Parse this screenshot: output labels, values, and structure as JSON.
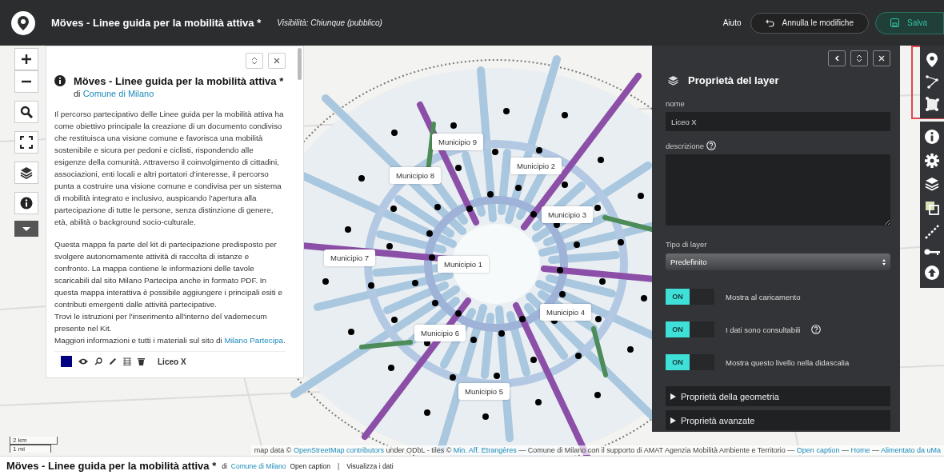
{
  "header": {
    "title": "Möves - Linee guida per la mobilità attiva *",
    "visibility": "Visibilità: Chiunque (pubblico)",
    "help_link": "Aiuto",
    "undo_button": "Annulla le modifiche",
    "save_button": "Salva"
  },
  "map_labels": [
    "Municipio 9",
    "Municipio 8",
    "Municipio 2",
    "Municipio 3",
    "Municipio 7",
    "Municipio 1",
    "Municipio 4",
    "Municipio 6",
    "Municipio 5"
  ],
  "info_panel": {
    "title": "Möves - Linee guida per la mobilità attiva *",
    "author_prefix": "di",
    "author": "Comune di Milano",
    "paragraphs": [
      {
        "kind": "para",
        "text": "Il percorso partecipativo delle Linee guida per la mobilità attiva ha come obiettivo principale la creazione di un documento condiviso che restituisca una visione comune e favorisca una mobilità sostenibile e sicura per pedoni e ciclisti, rispondendo alle esigenze della comunità. Attraverso il coinvolgimento di cittadini, associazioni, enti locali e altri portatori d’interesse, il percorso punta a costruire una visione comune e condivisa per un sistema di mobilità integrato e inclusivo, auspicando l’apertura alla partecipazione di tutte le persone, senza distinzione di genere, età, abilità o background socio-culturale."
      },
      {
        "kind": "line",
        "text": "Questa mappa fa parte del kit di partecipazione predisposto per svolgere autonomamente attività di raccolta di istanze e confronto. La mappa contiene le informazioni delle tavole scaricabili dal sito Milano Partecipa anche in formato PDF. In questa mappa interattiva è possibile aggiungere i principali esiti e contributi emergenti dalle attività partecipative."
      },
      {
        "kind": "line",
        "text": "Trovi le istruzioni per l'inserimento all'interno del vademecum presente nel Kit."
      },
      {
        "kind": "line",
        "text": "Maggiori informazioni e tutti i materiali sul sito di ",
        "link": "Milano Partecipa",
        "after": "."
      }
    ],
    "layer": {
      "color": "#000080",
      "name": "Liceo X"
    }
  },
  "layer_panel": {
    "title": "Proprietà del layer",
    "name_label": "nome",
    "name_value": "Liceo X",
    "description_label": "descrizione",
    "type_label": "Tipo di layer",
    "type_value": "Predefinito",
    "toggles": [
      {
        "label": "Mostra al caricamento",
        "on": true,
        "on_text": "ON",
        "help": false
      },
      {
        "label": "I dati sono consultabili",
        "on": true,
        "on_text": "ON",
        "help": true
      },
      {
        "label": "Mostra questo livello nella didascalia",
        "on": true,
        "on_text": "ON",
        "help": false
      }
    ],
    "sections": [
      {
        "label": "Proprietà della geometria",
        "expanded": false
      },
      {
        "label": "Proprietà avanzate",
        "expanded": false
      }
    ]
  },
  "scale": {
    "metric": "2 km",
    "imperial": "1 mi"
  },
  "attribution": [
    {
      "text": "map data © ",
      "link": false
    },
    {
      "text": "OpenStreetMap contributors",
      "link": true
    },
    {
      "text": " under ODbL - tiles © ",
      "link": false
    },
    {
      "text": "Min. Aff. Etrangères",
      "link": true
    },
    {
      "text": " — Comune di Milano con il supporto di AMAT Agenzia Mobilità Ambiente e Territorio — ",
      "link": false
    },
    {
      "text": "Open caption",
      "link": true
    },
    {
      "text": " — ",
      "link": false
    },
    {
      "text": "Home",
      "link": true
    },
    {
      "text": " — ",
      "link": false
    },
    {
      "text": "Alimentato da uMa",
      "link": true
    }
  ],
  "footer": {
    "title": "Möves - Linee guida per la mobilità attiva *",
    "author_prefix": "di",
    "author": "Comune di Milano",
    "caption_link": "Open caption",
    "separator": "|",
    "data_link": "Visualizza i dati"
  }
}
